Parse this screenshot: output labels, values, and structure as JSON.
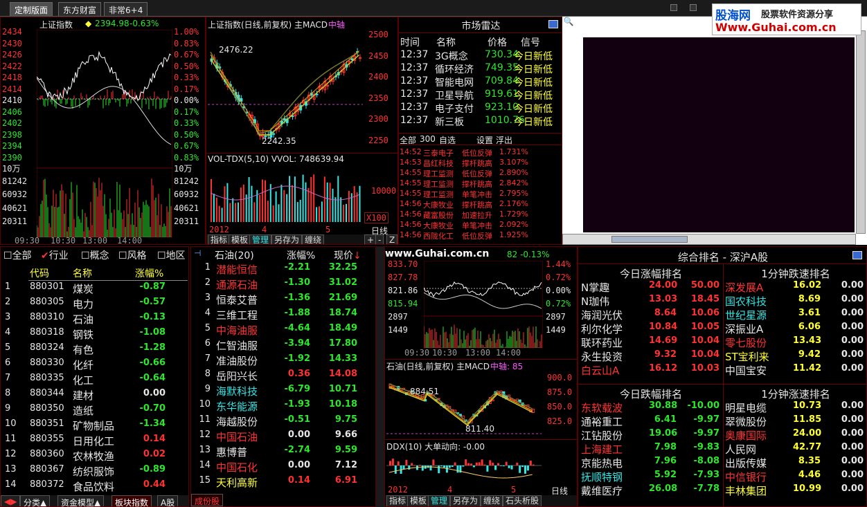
{
  "tabs": [
    "定制版面",
    "东方财富",
    "非常6+4"
  ],
  "logo": {
    "line1": "股海网",
    "line2": "股票软件资源分享",
    "line3": "Www.Guhai.com.cn"
  },
  "watermark": "www.Guhai.com.cn",
  "index_panel": {
    "title": "上证指数",
    "price": "2394.98",
    "change": "-0.63%",
    "left_axis": [
      "2434",
      "2430",
      "2426",
      "2422",
      "2418",
      "2414",
      "2410",
      "2406",
      "2402",
      "2398",
      "2394",
      "2390"
    ],
    "right_axis": [
      "1.00%",
      "0.83%",
      "0.67%",
      "0.50%",
      "0.33%",
      "0.17%",
      "0.00%",
      "0.17%",
      "0.33%",
      "0.50%",
      "0.67%",
      "0.83%"
    ],
    "vol_left": [
      "10万",
      "81242",
      "60932",
      "40621",
      "20311"
    ],
    "vol_right": [
      "10万",
      "81242",
      "60932",
      "40621",
      "20311"
    ],
    "time_axis": [
      "09:30",
      "10:30",
      "13:00",
      "14:00"
    ]
  },
  "kline_panel": {
    "title": "上证指数(日线,前复权) 主MACD",
    "tag": "中轴",
    "high": "2476.22",
    "low": "2242.35",
    "axis": [
      "2500",
      "2450",
      "2400",
      "2350",
      "2300",
      "2250"
    ],
    "vol_title": "VOL-TDX(5,10)  VVOL: 748639.94",
    "vol_axis": "10000",
    "vol_unit": "X100",
    "x_labels": [
      "2012年",
      "4",
      "5"
    ],
    "period": "日线",
    "tools": [
      "指标",
      "模板",
      "管理",
      "另存为",
      "缠绕"
    ]
  },
  "radar": {
    "title": "市场雷达",
    "cols": [
      "时间",
      "名称",
      "价格",
      "信号"
    ],
    "rows": [
      [
        "12:37",
        "3G概念",
        "730.34",
        "今日新低"
      ],
      [
        "12:37",
        "循环经济",
        "749.35",
        "今日新低"
      ],
      [
        "12:37",
        "智能电网",
        "709.84",
        "今日新低"
      ],
      [
        "12:37",
        "卫星导航",
        "919.61",
        "今日新低"
      ],
      [
        "12:37",
        "电子支付",
        "923.10",
        "今日新低"
      ],
      [
        "12:37",
        "新三板",
        "1010.76",
        "今日新低"
      ]
    ],
    "btns": [
      "全部",
      "300",
      "自选",
      "设置",
      "浮出"
    ],
    "alerts": [
      [
        "14:52",
        "三泰电子",
        "低位反弹",
        "1.731%"
      ],
      [
        "14:53",
        "昌红科技",
        "撑杆跳高",
        "3.107%"
      ],
      [
        "14:55",
        "理工监测",
        "低位反弹",
        "2.890%"
      ],
      [
        "14:55",
        "理工监测",
        "撑杆跳高",
        "2.842%"
      ],
      [
        "14:55",
        "理工监测",
        "单笔冲击",
        "2.795%"
      ],
      [
        "14:56",
        "大康牧业",
        "撑杆跳高",
        "2.176%"
      ],
      [
        "14:56",
        "藏富股份",
        "加速拉升",
        "1.729%"
      ],
      [
        "14:56",
        "大康牧业",
        "单笔冲击",
        "2.092%"
      ],
      [
        "14:56",
        "西陇化工",
        "低位反弹",
        "1.925%"
      ]
    ]
  },
  "sector": {
    "filters": [
      "全部",
      "行业",
      "概念",
      "风格",
      "地区"
    ],
    "cols": [
      "代码",
      "名称",
      "涨幅%"
    ],
    "rows": [
      [
        "1",
        "880301",
        "煤炭",
        "-0.87"
      ],
      [
        "2",
        "880305",
        "电力",
        "-0.57"
      ],
      [
        "3",
        "880310",
        "石油",
        "-0.13"
      ],
      [
        "4",
        "880318",
        "钢铁",
        "-1.08"
      ],
      [
        "5",
        "880324",
        "有色",
        "-1.28"
      ],
      [
        "6",
        "880330",
        "化纤",
        "-0.66"
      ],
      [
        "7",
        "880335",
        "化工",
        "-0.64"
      ],
      [
        "8",
        "880344",
        "建材",
        "0.00"
      ],
      [
        "9",
        "880350",
        "造纸",
        "-0.70"
      ],
      [
        "10",
        "880351",
        "矿物制品",
        "-1.34"
      ],
      [
        "11",
        "880355",
        "日用化工",
        "0.14"
      ],
      [
        "12",
        "880360",
        "农林牧渔",
        "0.02"
      ],
      [
        "13",
        "880367",
        "纺织服饰",
        "-0.89"
      ],
      [
        "14",
        "880372",
        "食品饮料",
        "0.44"
      ]
    ],
    "bottom_tabs": [
      "分类▲",
      "资金模型▲",
      "板块指数",
      "A股"
    ]
  },
  "stocks": {
    "title": "石油(20)",
    "cols": [
      "涨幅%",
      "现价"
    ],
    "rows": [
      [
        "1",
        "潜能恒信",
        "-2.21",
        "32.25"
      ],
      [
        "2",
        "通源石油",
        "-1.30",
        "31.02"
      ],
      [
        "3",
        "恒泰艾普",
        "-1.36",
        "21.69"
      ],
      [
        "4",
        "三维工程",
        "-1.88",
        "18.74"
      ],
      [
        "5",
        "中海油服",
        "-4.64",
        "18.49"
      ],
      [
        "6",
        "仁智油服",
        "-3.94",
        "17.80"
      ],
      [
        "7",
        "准油股份",
        "-1.92",
        "14.33"
      ],
      [
        "8",
        "岳阳兴长",
        "0.36",
        "14.08"
      ],
      [
        "9",
        "海默科技",
        "-6.79",
        "10.71"
      ],
      [
        "10",
        "东华能源",
        "-1.93",
        "10.18"
      ],
      [
        "11",
        "海越股份",
        "-0.51",
        "9.75"
      ],
      [
        "12",
        "中国石油",
        "0.00",
        "9.66"
      ],
      [
        "13",
        "惠博普",
        "-2.74",
        "9.59"
      ],
      [
        "14",
        "中国石化",
        "0.00",
        "7.12"
      ],
      [
        "15",
        "天利高新",
        "0.14",
        "6.91"
      ]
    ],
    "bottom": "成份股"
  },
  "oil_panel": {
    "price_info": "82  -0.13%",
    "left_axis": [
      "833.70",
      "827.78",
      "821.86",
      "815.94",
      "2897",
      "1449"
    ],
    "right_axis": [
      "1.44%",
      "0.72%",
      "0.00%",
      "0.72%",
      "2897",
      "1449"
    ],
    "time_axis": [
      "09:30",
      "10:30",
      "13:00",
      "14:00"
    ],
    "kline_title": "石油(日线,前复权) 主MACD",
    "kline_tag": "中轴: 85",
    "kline_high": "884.51",
    "kline_low": "811.40",
    "kline_axis": [
      "900.0",
      "875.0",
      "850.0",
      "825.0"
    ],
    "ddx_title": "DDX(10) 大单动向: -0.00",
    "x_labels": [
      "2012年",
      "4",
      "5"
    ],
    "period": "日线",
    "tools": [
      "指标",
      "模板",
      "管理",
      "另存为",
      "缠绕",
      "石头析股"
    ]
  },
  "ranking": {
    "title": "综合排名 - 深沪A股",
    "gain_title": "今日涨幅排名",
    "speed_up_title": "1分钟跌速排名",
    "loss_title": "今日跌幅排名",
    "speed_down_title": "1分钟涨速排名",
    "gain": [
      [
        "N掌趣",
        "24.00",
        "50.00"
      ],
      [
        "N珈伟",
        "13.03",
        "18.45"
      ],
      [
        "海润光伏",
        "8.64",
        "10.06"
      ],
      [
        "利尔化学",
        "10.84",
        "10.05"
      ],
      [
        "联环药业",
        "14.69",
        "10.04"
      ],
      [
        "永生投资",
        "9.32",
        "10.04"
      ],
      [
        "白云山A",
        "16.12",
        "10.03"
      ]
    ],
    "speed1": [
      [
        "深发展A",
        "16.02",
        "0.00"
      ],
      [
        "国农科技",
        "8.69",
        "0.00"
      ],
      [
        "世纪星源",
        "3.61",
        "0.00"
      ],
      [
        "深振业A",
        "6.06",
        "0.00"
      ],
      [
        "零七股份",
        "13.43",
        "0.00"
      ],
      [
        "ST宝利来",
        "9.42",
        "0.00"
      ],
      [
        "中国宝安",
        "11.42",
        "0.00"
      ]
    ],
    "loss": [
      [
        "东软载波",
        "30.88",
        "-10.00"
      ],
      [
        "通裕重工",
        "6.41",
        "-9.97"
      ],
      [
        "江钻股份",
        "19.06",
        "-9.97"
      ],
      [
        "上海建工",
        "7.98",
        "-9.83"
      ],
      [
        "京能热电",
        "7.96",
        "-8.08"
      ],
      [
        "抚顺特钢",
        "5.92",
        "-7.93"
      ],
      [
        "戴维医疗",
        "26.08",
        "-7.78"
      ]
    ],
    "speed2": [
      [
        "明星电缆",
        "10.73",
        "0.00"
      ],
      [
        "翠微股份",
        "11.85",
        "0.00"
      ],
      [
        "奥康国际",
        "24.00",
        "0.00"
      ],
      [
        "人民网",
        "42.77",
        "0.00"
      ],
      [
        "出版传媒",
        "8.35",
        "0.00"
      ],
      [
        "中信银行",
        "4.46",
        "0.00"
      ],
      [
        "丰林集团",
        "10.99",
        "0.00"
      ]
    ]
  }
}
